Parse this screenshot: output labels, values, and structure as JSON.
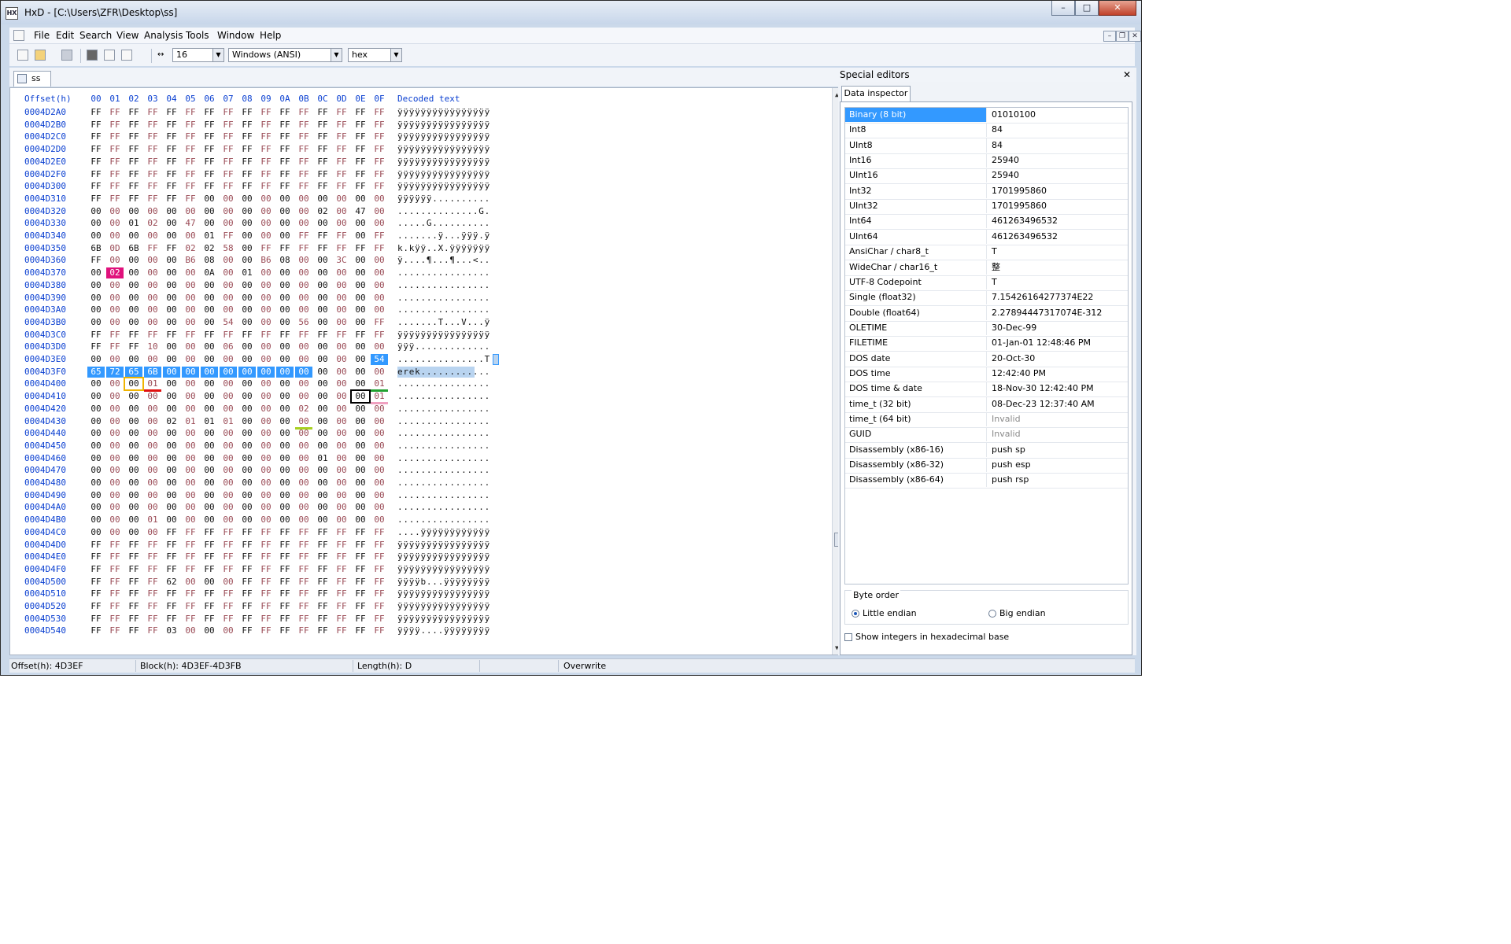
{
  "window": {
    "title": "HxD - [C:\\Users\\ZFR\\Desktop\\ss]",
    "caption_buttons": [
      "–",
      "□",
      "✕"
    ]
  },
  "menu": [
    "File",
    "Edit",
    "Search",
    "View",
    "Analysis",
    "Tools",
    "Window",
    "Help"
  ],
  "toolbar": {
    "bytes_per_row": "16",
    "charset": "Windows (ANSI)",
    "number_base": "hex"
  },
  "tab": {
    "label": "ss"
  },
  "hex_header": {
    "offset_label": "Offset(h)",
    "columns": [
      "00",
      "01",
      "02",
      "03",
      "04",
      "05",
      "06",
      "07",
      "08",
      "09",
      "0A",
      "0B",
      "0C",
      "0D",
      "0E",
      "0F"
    ],
    "decoded_label": "Decoded text"
  },
  "hex_rows": [
    {
      "offset": "0004D2A0",
      "bytes": "FF FF FF FF FF FF FF FF FF FF FF FF FF FF FF FF",
      "text": "ÿÿÿÿÿÿÿÿÿÿÿÿÿÿÿÿ"
    },
    {
      "offset": "0004D2B0",
      "bytes": "FF FF FF FF FF FF FF FF FF FF FF FF FF FF FF FF",
      "text": "ÿÿÿÿÿÿÿÿÿÿÿÿÿÿÿÿ"
    },
    {
      "offset": "0004D2C0",
      "bytes": "FF FF FF FF FF FF FF FF FF FF FF FF FF FF FF FF",
      "text": "ÿÿÿÿÿÿÿÿÿÿÿÿÿÿÿÿ"
    },
    {
      "offset": "0004D2D0",
      "bytes": "FF FF FF FF FF FF FF FF FF FF FF FF FF FF FF FF",
      "text": "ÿÿÿÿÿÿÿÿÿÿÿÿÿÿÿÿ"
    },
    {
      "offset": "0004D2E0",
      "bytes": "FF FF FF FF FF FF FF FF FF FF FF FF FF FF FF FF",
      "text": "ÿÿÿÿÿÿÿÿÿÿÿÿÿÿÿÿ"
    },
    {
      "offset": "0004D2F0",
      "bytes": "FF FF FF FF FF FF FF FF FF FF FF FF FF FF FF FF",
      "text": "ÿÿÿÿÿÿÿÿÿÿÿÿÿÿÿÿ"
    },
    {
      "offset": "0004D300",
      "bytes": "FF FF FF FF FF FF FF FF FF FF FF FF FF FF FF FF",
      "text": "ÿÿÿÿÿÿÿÿÿÿÿÿÿÿÿÿ"
    },
    {
      "offset": "0004D310",
      "bytes": "FF FF FF FF FF FF 00 00 00 00 00 00 00 00 00 00",
      "text": "ÿÿÿÿÿÿ.........."
    },
    {
      "offset": "0004D320",
      "bytes": "00 00 00 00 00 00 00 00 00 00 00 00 02 00 47 00",
      "text": "..............G."
    },
    {
      "offset": "0004D330",
      "bytes": "00 00 01 02 00 47 00 00 00 00 00 00 00 00 00 00",
      "text": ".....G.........."
    },
    {
      "offset": "0004D340",
      "bytes": "00 00 00 00 00 00 01 FF 00 00 00 FF FF FF 00 FF",
      "text": ".......ÿ...ÿÿÿ.ÿ"
    },
    {
      "offset": "0004D350",
      "bytes": "6B 0D 6B FF FF 02 02 58 00 FF FF FF FF FF FF FF",
      "text": "k.kÿÿ..X.ÿÿÿÿÿÿÿ"
    },
    {
      "offset": "0004D360",
      "bytes": "FF 00 00 00 00 B6 08 00 00 B6 08 00 00 3C 00 00",
      "text": "ÿ....¶...¶...<.."
    },
    {
      "offset": "0004D370",
      "bytes": "00 02 00 00 00 00 0A 00 01 00 00 00 00 00 00 00",
      "text": "................"
    },
    {
      "offset": "0004D380",
      "bytes": "00 00 00 00 00 00 00 00 00 00 00 00 00 00 00 00",
      "text": "................"
    },
    {
      "offset": "0004D390",
      "bytes": "00 00 00 00 00 00 00 00 00 00 00 00 00 00 00 00",
      "text": "................"
    },
    {
      "offset": "0004D3A0",
      "bytes": "00 00 00 00 00 00 00 00 00 00 00 00 00 00 00 00",
      "text": "................"
    },
    {
      "offset": "0004D3B0",
      "bytes": "00 00 00 00 00 00 00 54 00 00 00 56 00 00 00 FF",
      "text": ".......T...V...ÿ"
    },
    {
      "offset": "0004D3C0",
      "bytes": "FF FF FF FF FF FF FF FF FF FF FF FF FF FF FF FF",
      "text": "ÿÿÿÿÿÿÿÿÿÿÿÿÿÿÿÿ"
    },
    {
      "offset": "0004D3D0",
      "bytes": "FF FF FF 10 00 00 00 06 00 00 00 00 00 00 00 00",
      "text": "ÿÿÿ............."
    },
    {
      "offset": "0004D3E0",
      "bytes": "00 00 00 00 00 00 00 00 00 00 00 00 00 00 00 54",
      "text": "...............T"
    },
    {
      "offset": "0004D3F0",
      "bytes": "65 72 65 6B 00 00 00 00 00 00 00 00 00 00 00 00",
      "text": "erek............"
    },
    {
      "offset": "0004D400",
      "bytes": "00 00 00 01 00 00 00 00 00 00 00 00 00 00 00 01",
      "text": "................"
    },
    {
      "offset": "0004D410",
      "bytes": "00 00 00 00 00 00 00 00 00 00 00 00 00 00 00 01",
      "text": "................"
    },
    {
      "offset": "0004D420",
      "bytes": "00 00 00 00 00 00 00 00 00 00 00 02 00 00 00 00",
      "text": "................"
    },
    {
      "offset": "0004D430",
      "bytes": "00 00 00 00 02 01 01 01 00 00 00 00 00 00 00 00",
      "text": "................"
    },
    {
      "offset": "0004D440",
      "bytes": "00 00 00 00 00 00 00 00 00 00 00 00 00 00 00 00",
      "text": "................"
    },
    {
      "offset": "0004D450",
      "bytes": "00 00 00 00 00 00 00 00 00 00 00 00 00 00 00 00",
      "text": "................"
    },
    {
      "offset": "0004D460",
      "bytes": "00 00 00 00 00 00 00 00 00 00 00 00 01 00 00 00",
      "text": "................"
    },
    {
      "offset": "0004D470",
      "bytes": "00 00 00 00 00 00 00 00 00 00 00 00 00 00 00 00",
      "text": "................"
    },
    {
      "offset": "0004D480",
      "bytes": "00 00 00 00 00 00 00 00 00 00 00 00 00 00 00 00",
      "text": "................"
    },
    {
      "offset": "0004D490",
      "bytes": "00 00 00 00 00 00 00 00 00 00 00 00 00 00 00 00",
      "text": "................"
    },
    {
      "offset": "0004D4A0",
      "bytes": "00 00 00 00 00 00 00 00 00 00 00 00 00 00 00 00",
      "text": "................"
    },
    {
      "offset": "0004D4B0",
      "bytes": "00 00 00 01 00 00 00 00 00 00 00 00 00 00 00 00",
      "text": "................"
    },
    {
      "offset": "0004D4C0",
      "bytes": "00 00 00 00 FF FF FF FF FF FF FF FF FF FF FF FF",
      "text": "....ÿÿÿÿÿÿÿÿÿÿÿÿ"
    },
    {
      "offset": "0004D4D0",
      "bytes": "FF FF FF FF FF FF FF FF FF FF FF FF FF FF FF FF",
      "text": "ÿÿÿÿÿÿÿÿÿÿÿÿÿÿÿÿ"
    },
    {
      "offset": "0004D4E0",
      "bytes": "FF FF FF FF FF FF FF FF FF FF FF FF FF FF FF FF",
      "text": "ÿÿÿÿÿÿÿÿÿÿÿÿÿÿÿÿ"
    },
    {
      "offset": "0004D4F0",
      "bytes": "FF FF FF FF FF FF FF FF FF FF FF FF FF FF FF FF",
      "text": "ÿÿÿÿÿÿÿÿÿÿÿÿÿÿÿÿ"
    },
    {
      "offset": "0004D500",
      "bytes": "FF FF FF FF 62 00 00 00 FF FF FF FF FF FF FF FF",
      "text": "ÿÿÿÿb...ÿÿÿÿÿÿÿÿ"
    },
    {
      "offset": "0004D510",
      "bytes": "FF FF FF FF FF FF FF FF FF FF FF FF FF FF FF FF",
      "text": "ÿÿÿÿÿÿÿÿÿÿÿÿÿÿÿÿ"
    },
    {
      "offset": "0004D520",
      "bytes": "FF FF FF FF FF FF FF FF FF FF FF FF FF FF FF FF",
      "text": "ÿÿÿÿÿÿÿÿÿÿÿÿÿÿÿÿ"
    },
    {
      "offset": "0004D530",
      "bytes": "FF FF FF FF FF FF FF FF FF FF FF FF FF FF FF FF",
      "text": "ÿÿÿÿÿÿÿÿÿÿÿÿÿÿÿÿ"
    },
    {
      "offset": "0004D540",
      "bytes": "FF FF FF FF 03 00 00 00 FF FF FF FF FF FF FF FF",
      "text": "ÿÿÿÿ....ÿÿÿÿÿÿÿÿ"
    }
  ],
  "special_editors": {
    "title": "Special editors",
    "tab": "Data inspector",
    "rows": [
      {
        "k": "Binary (8 bit)",
        "v": "01010100"
      },
      {
        "k": "Int8",
        "v": "84"
      },
      {
        "k": "UInt8",
        "v": "84"
      },
      {
        "k": "Int16",
        "v": "25940"
      },
      {
        "k": "UInt16",
        "v": "25940"
      },
      {
        "k": "Int32",
        "v": "1701995860"
      },
      {
        "k": "UInt32",
        "v": "1701995860"
      },
      {
        "k": "Int64",
        "v": "461263496532"
      },
      {
        "k": "UInt64",
        "v": "461263496532"
      },
      {
        "k": "AnsiChar / char8_t",
        "v": "T"
      },
      {
        "k": "WideChar / char16_t",
        "v": "整"
      },
      {
        "k": "UTF-8 Codepoint",
        "v": "T"
      },
      {
        "k": "Single (float32)",
        "v": "7.15426164277374E22"
      },
      {
        "k": "Double (float64)",
        "v": "2.27894447317074E-312"
      },
      {
        "k": "OLETIME",
        "v": "30-Dec-99"
      },
      {
        "k": "FILETIME",
        "v": "01-Jan-01 12:48:46 PM"
      },
      {
        "k": "DOS date",
        "v": "20-Oct-30"
      },
      {
        "k": "DOS time",
        "v": "12:42:40 PM"
      },
      {
        "k": "DOS time & date",
        "v": "18-Nov-30 12:42:40 PM"
      },
      {
        "k": "time_t (32 bit)",
        "v": "08-Dec-23 12:37:40 AM"
      },
      {
        "k": "time_t (64 bit)",
        "v": "Invalid"
      },
      {
        "k": "GUID",
        "v": "Invalid"
      },
      {
        "k": "Disassembly (x86-16)",
        "v": "push sp"
      },
      {
        "k": "Disassembly (x86-32)",
        "v": "push esp"
      },
      {
        "k": "Disassembly (x86-64)",
        "v": "push rsp"
      }
    ],
    "byte_order": {
      "label": "Byte order",
      "little": "Little endian",
      "big": "Big endian",
      "selected": "Little endian"
    },
    "hex_checkbox": "Show integers in hexadecimal base"
  },
  "status": {
    "offset": "Offset(h): 4D3EF",
    "block": "Block(h): 4D3EF-4D3FB",
    "length": "Length(h): D",
    "mode": "Overwrite"
  },
  "colors": {
    "selection": "#3399ff",
    "offset_blue": "#0a3fd1",
    "pink_mark": "#e0117c",
    "yellow_mark": "#f0b400",
    "red_underline": "#e01010",
    "green_underline": "#22a030",
    "lime_underline": "#a8d020",
    "light_pink_underline": "#f0a0c0"
  }
}
